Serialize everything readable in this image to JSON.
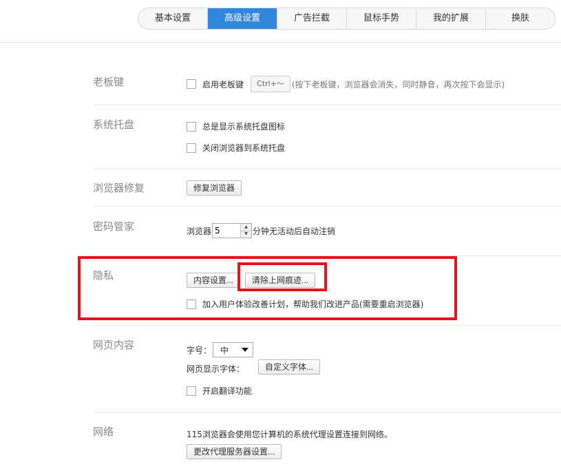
{
  "tabs": [
    {
      "label": "基本设置"
    },
    {
      "label": "高级设置"
    },
    {
      "label": "广告拦截"
    },
    {
      "label": "鼠标手势"
    },
    {
      "label": "我的扩展"
    },
    {
      "label": "换肤"
    }
  ],
  "colors": {
    "accent": "#2f86dc",
    "highlight": "#e8121a"
  },
  "boss_key": {
    "title": "老板键",
    "checkbox_label": "启用老板键",
    "shortcut": "Ctrl+～",
    "hint": "(按下老板键，浏览器会消失，同时静音，再次按下会显示)"
  },
  "tray": {
    "title": "系统托盘",
    "option1": "总是显示系统托盘图标",
    "option2": "关闭浏览器到系统托盘"
  },
  "repair": {
    "title": "浏览器修复",
    "button": "修复浏览器"
  },
  "password": {
    "title": "密码管家",
    "prefix": "浏览器",
    "minutes": "5",
    "suffix": "分钟无活动后自动注销"
  },
  "privacy": {
    "title": "隐私",
    "content_button": "内容设置...",
    "clear_button": "清除上网痕迹...",
    "experience_label": "加入用户体验改善计划，帮助我们改进产品(需要重启浏览器)"
  },
  "webcontent": {
    "title": "网页内容",
    "font_size_label": "字号：",
    "font_size_value": "中",
    "font_face_label": "网页显示字体：",
    "custom_font_button": "自定义字体...",
    "translate_label": "开启翻译功能"
  },
  "network": {
    "title": "网络",
    "description": "115浏览器会使用您计算机的系统代理设置连接到网络。",
    "proxy_button": "更改代理服务器设置..."
  }
}
